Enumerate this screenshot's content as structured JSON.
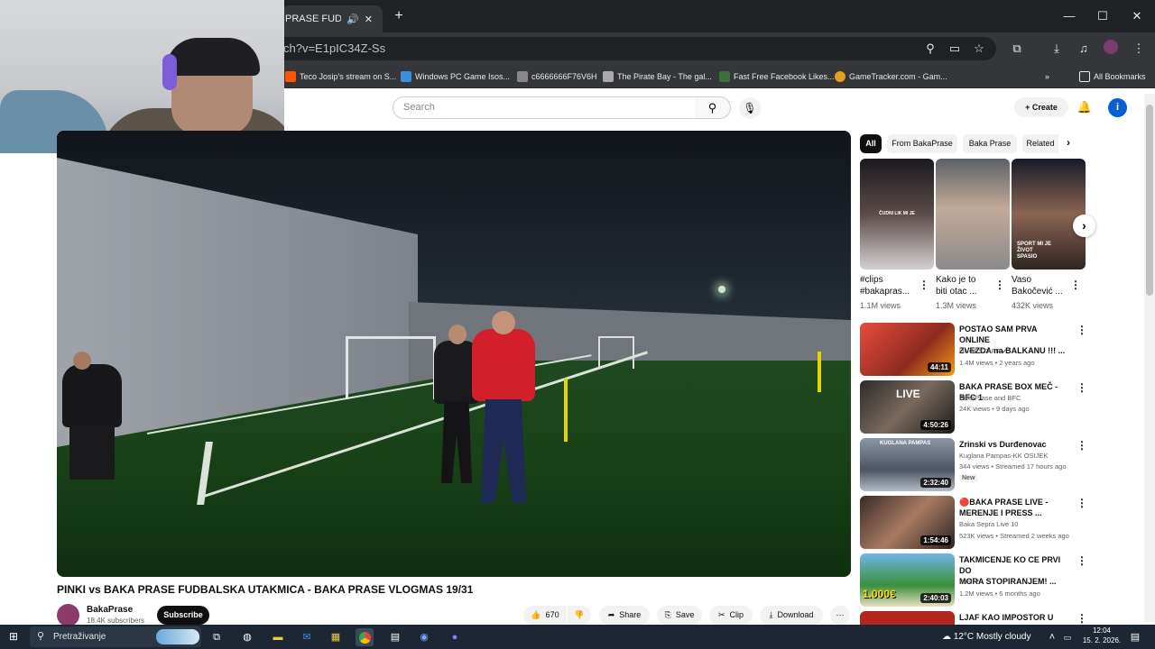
{
  "browser": {
    "active_tab_title": "PRASE FUDBALSKA",
    "url": "ch?v=E1pIC34Z-Ss",
    "bookmarks": [
      "Teco Josip's stream on S...",
      "Windows PC Game Isos...",
      "c6666666F76V6H",
      "The Pirate Bay - The gal...",
      "Fast Free Facebook Likes...",
      "GameTracker.com - Gam..."
    ],
    "all_bookmarks_label": "All Bookmarks"
  },
  "youtube": {
    "search_placeholder": "Search",
    "create_label": "Create",
    "avatar_letter": "i"
  },
  "video": {
    "title": "PINKI vs BAKA PRASE FUDBALSKA UTAKMICA - BAKA PRASE VLOGMAS 19/31",
    "channel": "BakaPrase",
    "subscribers": "18.4K subscribers",
    "subscribe_label": "Subscribe",
    "likes": "670",
    "share_label": "Share",
    "save_label": "Save",
    "clip_label": "Clip",
    "download_label": "Download"
  },
  "sidebar": {
    "chips": [
      "All",
      "From BakaPrase",
      "Baka Prase",
      "Related"
    ],
    "shorts": [
      {
        "title_line1": "#clips",
        "title_line2": "#bakapras...",
        "views": "1.1M views",
        "overlay": "ČUDNI LIK MI JE"
      },
      {
        "title_line1": "Kako je to",
        "title_line2": "biti otac ...",
        "views": "1.3M views",
        "overlay": ""
      },
      {
        "title_line1": "Vaso",
        "title_line2": "Bakočević ...",
        "views": "432K views",
        "overlay": "SPORT MI JE ŽIVOT SPASIO"
      }
    ],
    "videos": [
      {
        "title_line1": "POSTAO SAM PRVA ONLINE",
        "title_line2": "ZVEZDA na BALKANU !!! ...",
        "channel": "HUGESTAFF",
        "stats": "1.4M views • 2 years ago",
        "duration": "44:11",
        "thumb_color": "#c0392b"
      },
      {
        "title_line1": "BAKA PRASE BOX MEČ - BFC 1",
        "title_line2": "",
        "channel": "BakaPrase and BFC",
        "stats": "24K views • 9 days ago",
        "duration": "4:50:26",
        "thumb_color": "#3a3a3a"
      },
      {
        "title_line1": "Zrinski vs Durđenovac",
        "title_line2": "",
        "channel": "Kuglana Pampas-KK OSIJEK",
        "stats": "344 views • Streamed 17 hours ago",
        "duration": "2:32:40",
        "badge": "New",
        "thumb_color": "#6d7a8a"
      },
      {
        "title_line1": "🔴BAKA PRASE LIVE -",
        "title_line2": "MERENJE I PRESS ...",
        "channel": "Baka Sepra Live 10",
        "stats": "523K views • Streamed 2 weeks ago",
        "duration": "1:54:46",
        "thumb_color": "#4b3b36"
      },
      {
        "title_line1": "TAKMICENJE KO CE PRVI DO",
        "title_line2": "MORA STOPIRANJEM! ...",
        "channel": "Simi",
        "stats": "1.2M views • 6 months ago",
        "duration": "2:40:03",
        "thumb_color": "#3b8f3b",
        "overlay": "1.000€"
      },
      {
        "title_line1": "LJAF KAO IMPOSTOR U",
        "title_line2": "",
        "channel": "",
        "stats": "",
        "duration": "",
        "thumb_color": "#b3261e"
      }
    ]
  },
  "taskbar": {
    "search_label": "Pretraživanje",
    "temperature": "12°C",
    "weather": "Mostly cloudy",
    "time": "12:04",
    "date": "15. 2. 2026."
  },
  "colors": {
    "yt_red": "#ff0000",
    "chrome_dark": "#35363a",
    "taskbar": "#1c2733"
  }
}
